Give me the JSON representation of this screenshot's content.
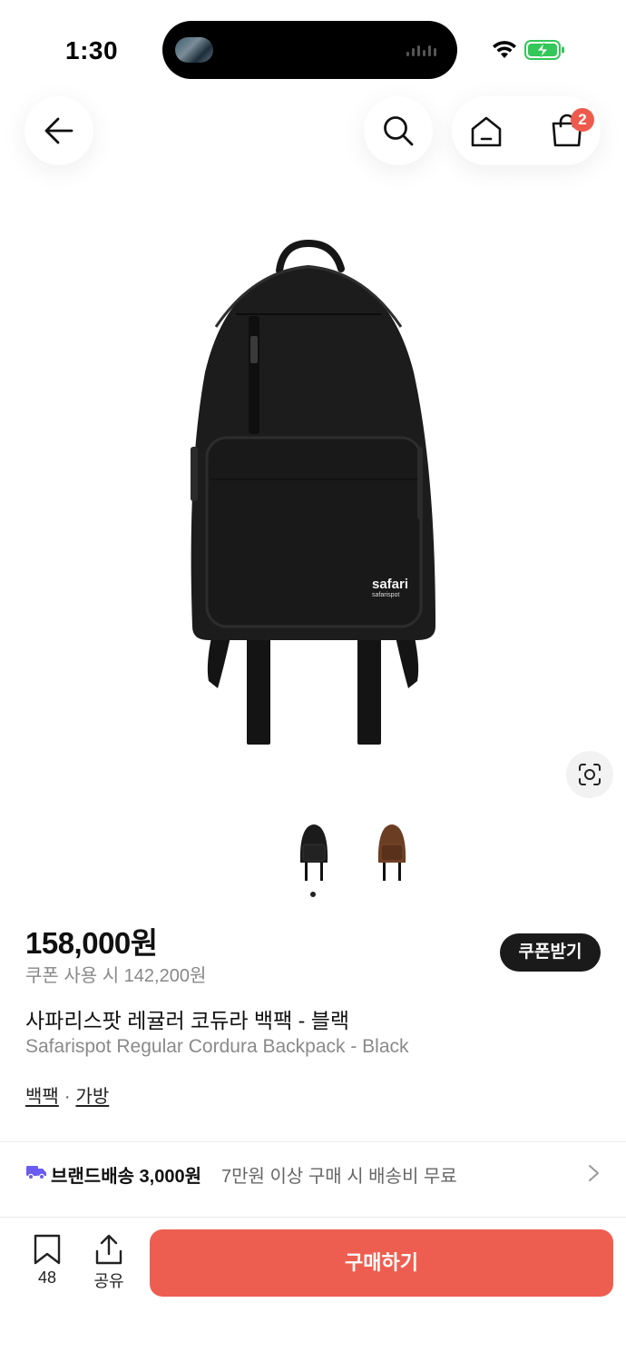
{
  "status_bar": {
    "time": "1:30"
  },
  "nav": {
    "back_icon": "arrow-left-icon",
    "search_icon": "search-icon",
    "home_icon": "home-icon",
    "cart_icon": "shopping-bag-icon",
    "cart_count": "2"
  },
  "gallery": {
    "lens_icon": "visual-search-icon",
    "colors": [
      {
        "name": "black",
        "color": "#1b1b1b"
      },
      {
        "name": "brown",
        "color": "#6b3d22"
      }
    ],
    "active_index": 0,
    "brand_logo_text": "safari",
    "brand_logo_subtext": "safarispot"
  },
  "product": {
    "price": "158,000원",
    "coupon_price": "쿠폰 사용 시 142,200원",
    "coupon_button": "쿠폰받기",
    "title_ko": "사파리스팟 레귤러 코듀라 백팩 - 블랙",
    "title_en": "Safarispot Regular Cordura Backpack - Black",
    "category": [
      "백팩",
      "가방"
    ],
    "category_separator": "·"
  },
  "shipping": {
    "label": "브랜드배송 3,000원",
    "note": "7만원 이상 구매 시 배송비 무료",
    "icon": "truck-icon",
    "icon_color": "#6a5cf0"
  },
  "bottom_bar": {
    "bookmark_count": "48",
    "share_label": "공유",
    "buy_label": "구매하기",
    "buy_color": "#ee5e50"
  }
}
